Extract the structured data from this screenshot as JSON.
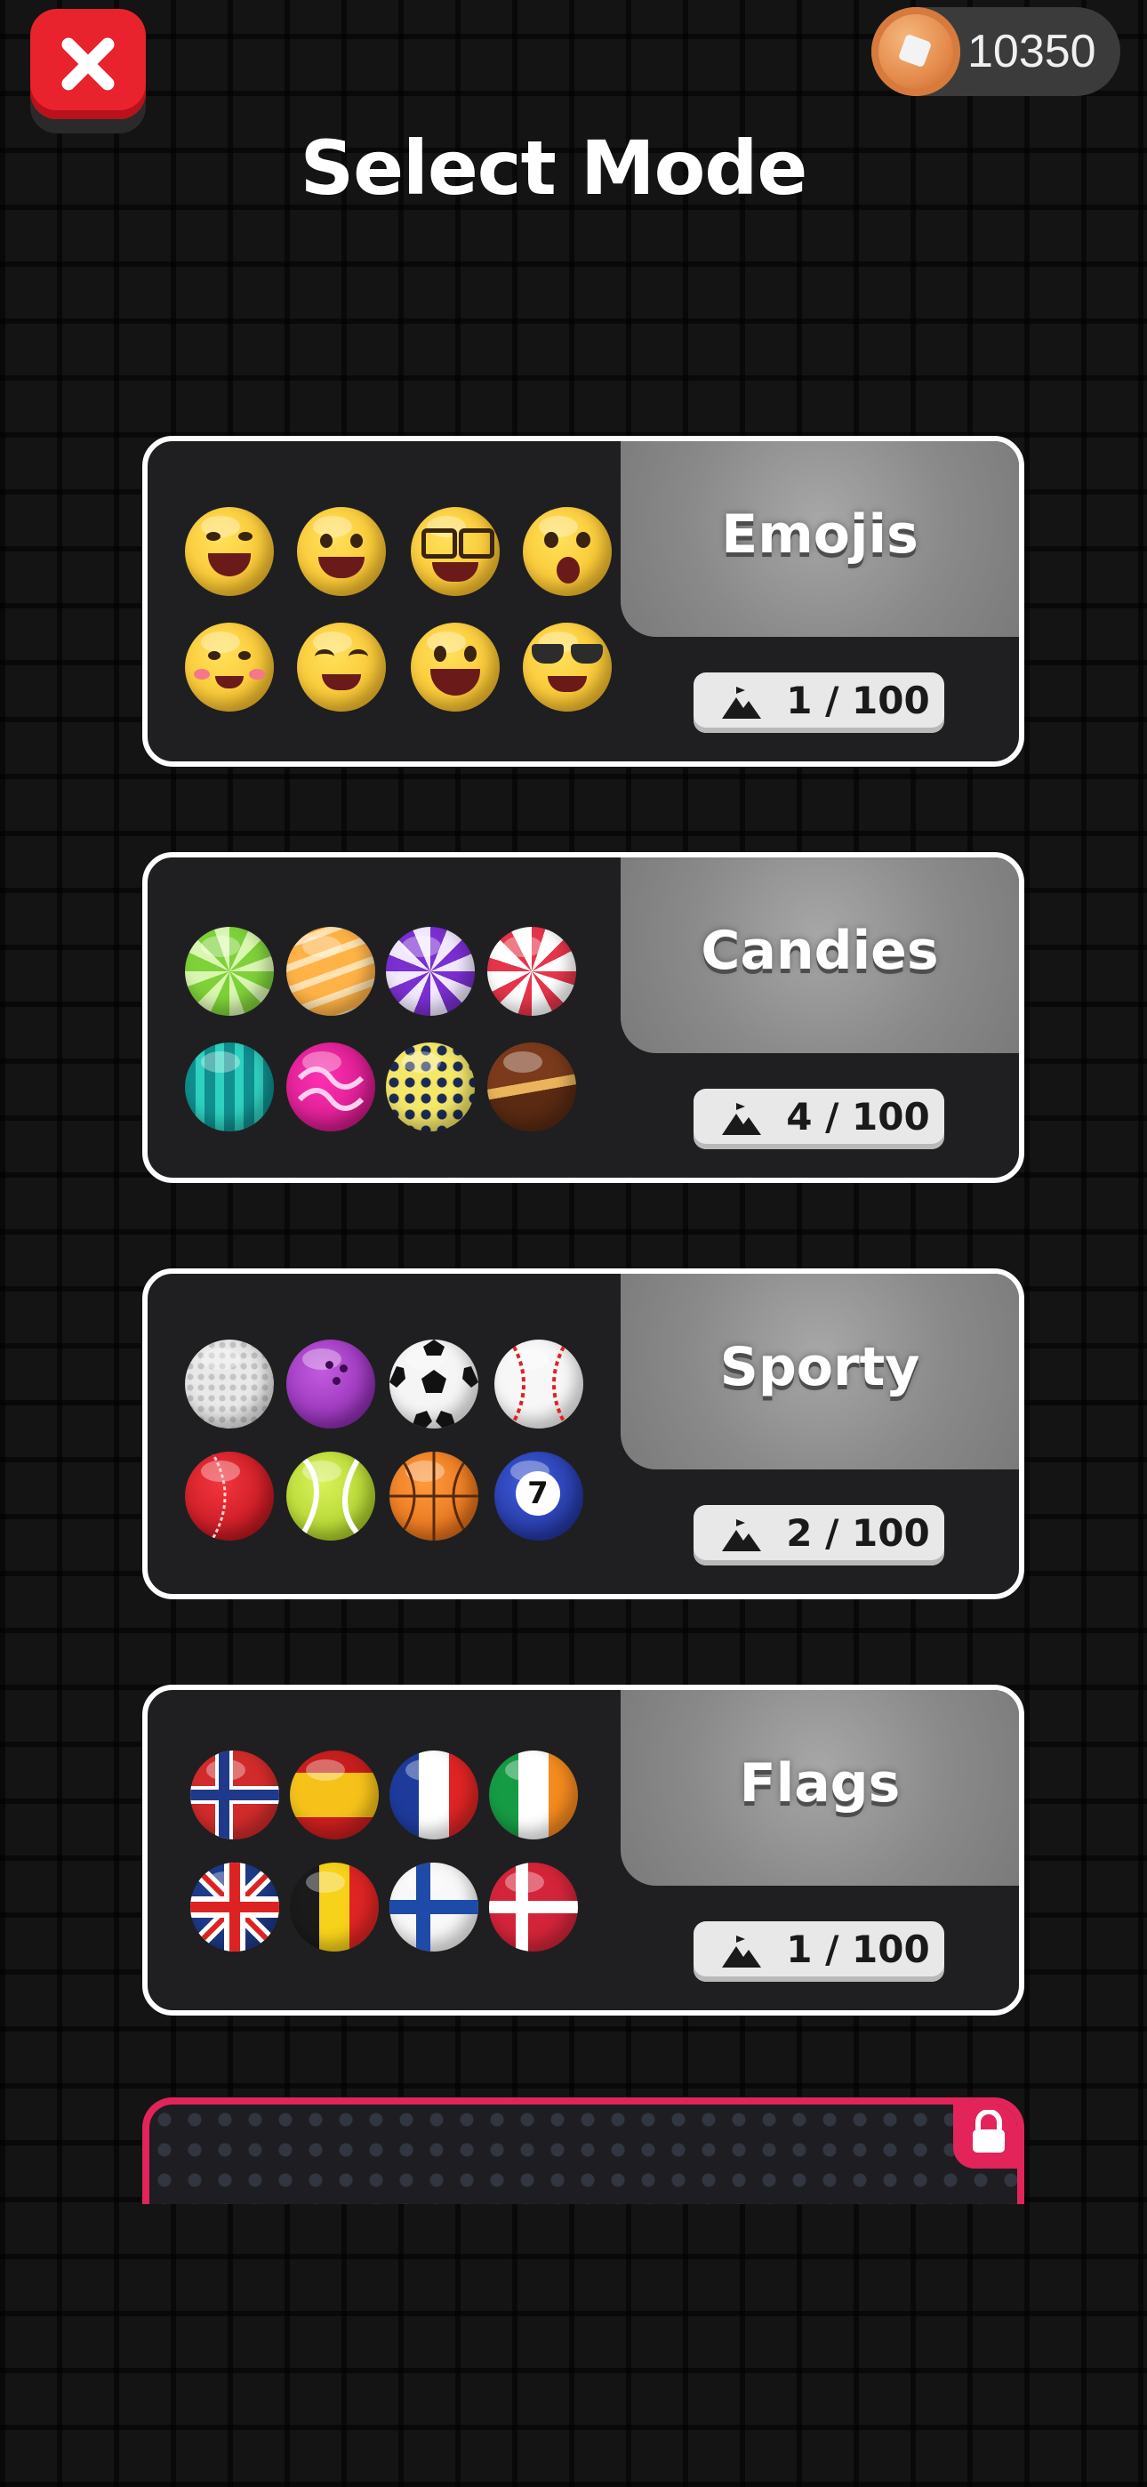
{
  "header": {
    "close_icon": "close-icon",
    "coins": "10350",
    "coin_icon": "coin-icon",
    "title": "Select Mode"
  },
  "colors": {
    "background": "#141414",
    "close_button": "#e8232d",
    "card_border": "#ffffff",
    "locked_border": "#e2245a",
    "name_panel": "#8a8a8a"
  },
  "modes": [
    {
      "name": "Emojis",
      "progress": "1 / 100",
      "progress_icon": "mountain-flag-icon",
      "items": [
        "laughing-face-icon",
        "grinning-face-icon",
        "nerd-glasses-face-icon",
        "surprised-face-icon",
        "blushing-face-icon",
        "smiling-eyes-face-icon",
        "grinning-open-face-icon",
        "sunglasses-face-icon"
      ]
    },
    {
      "name": "Candies",
      "progress": "4 / 100",
      "progress_icon": "mountain-flag-icon",
      "items": [
        "green-swirl-candy-icon",
        "orange-striped-candy-icon",
        "purple-swirl-candy-icon",
        "peppermint-candy-icon",
        "teal-striped-candy-icon",
        "pink-wavy-candy-icon",
        "yellow-dotted-candy-icon",
        "chocolate-candy-icon"
      ]
    },
    {
      "name": "Sporty",
      "progress": "2 / 100",
      "progress_icon": "mountain-flag-icon",
      "items": [
        "golf-ball-icon",
        "bowling-ball-icon",
        "soccer-ball-icon",
        "baseball-icon",
        "cricket-ball-icon",
        "tennis-ball-icon",
        "basketball-icon",
        "billiard-ball-7-icon"
      ],
      "billiard_number": "7"
    },
    {
      "name": "Flags",
      "progress": "1 / 100",
      "progress_icon": "mountain-flag-icon",
      "items": [
        "norway-flag-icon",
        "spain-flag-icon",
        "france-flag-icon",
        "ireland-flag-icon",
        "uk-flag-icon",
        "belgium-flag-icon",
        "finland-flag-icon",
        "denmark-flag-icon"
      ]
    }
  ],
  "locked_mode": {
    "lock_icon": "lock-icon"
  }
}
